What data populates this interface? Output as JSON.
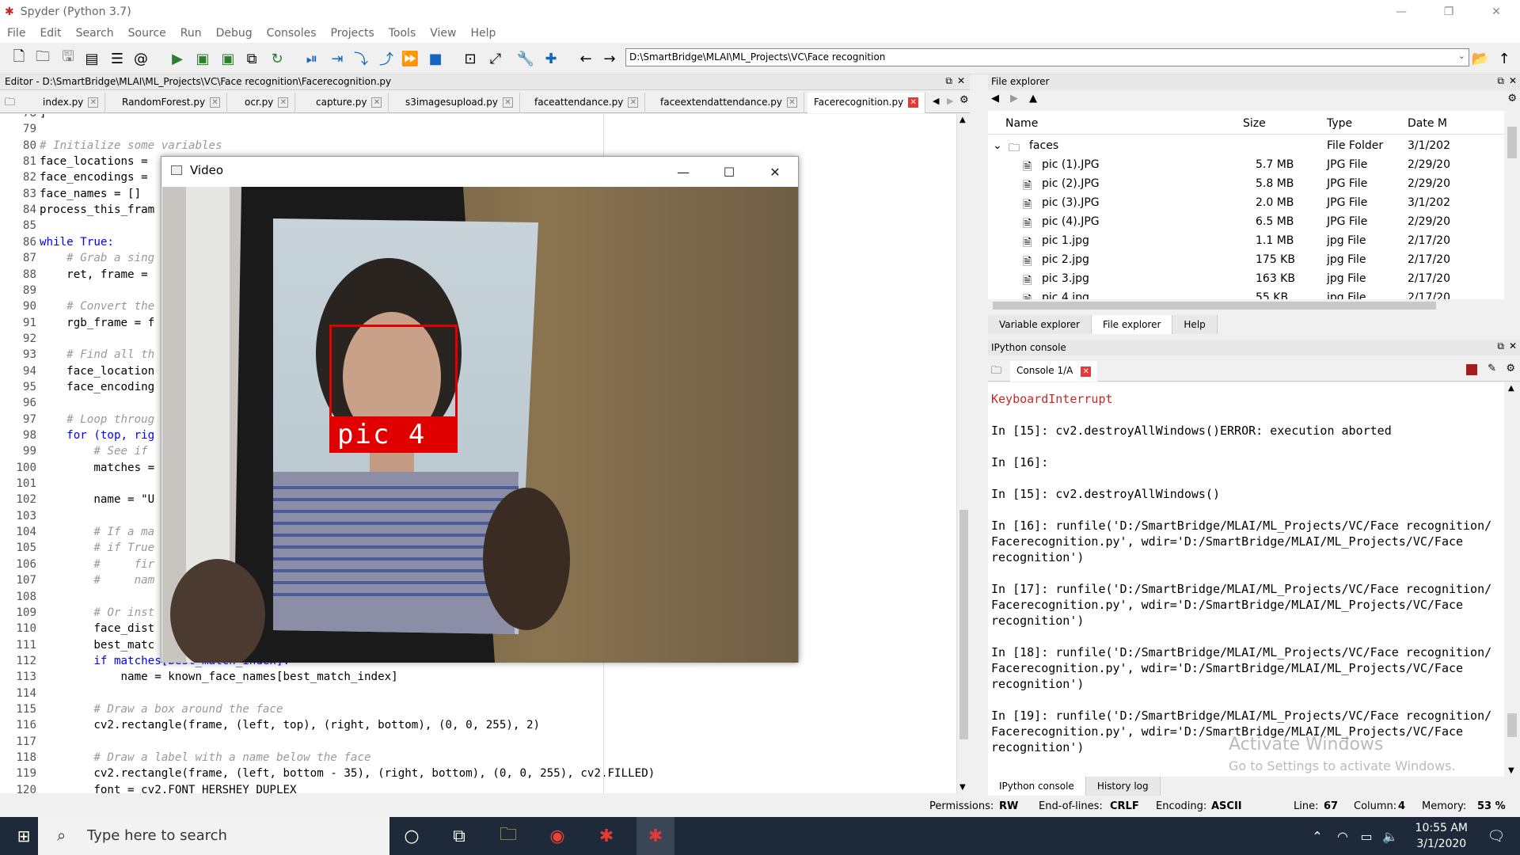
{
  "window": {
    "title": "Spyder (Python 3.7)",
    "minimize": "—",
    "restore": "❐",
    "close": "✕"
  },
  "menu": [
    "File",
    "Edit",
    "Search",
    "Source",
    "Run",
    "Debug",
    "Consoles",
    "Projects",
    "Tools",
    "View",
    "Help"
  ],
  "toolbar": {
    "path": "D:\\SmartBridge\\MLAI\\ML_Projects\\VC\\Face recognition"
  },
  "editor": {
    "header": "Editor - D:\\SmartBridge\\MLAI\\ML_Projects\\VC\\Face recognition\\Facerecognition.py",
    "tabs": [
      "index.py",
      "RandomForest.py",
      "ocr.py",
      "capture.py",
      "s3imagesupload.py",
      "faceattendance.py",
      "faceextendattendance.py",
      "Facerecognition.py"
    ],
    "active_tab": "Facerecognition.py",
    "lines": [
      {
        "n": "78",
        "t": "]",
        "c": ""
      },
      {
        "n": "79",
        "t": "",
        "c": ""
      },
      {
        "n": "80",
        "t": "# Initialize some variables",
        "c": "cm"
      },
      {
        "n": "81",
        "t": "face_locations = ",
        "c": ""
      },
      {
        "n": "82",
        "t": "face_encodings = ",
        "c": ""
      },
      {
        "n": "83",
        "t": "face_names = []",
        "c": ""
      },
      {
        "n": "84",
        "t": "process_this_fram",
        "c": ""
      },
      {
        "n": "85",
        "t": "",
        "c": ""
      },
      {
        "n": "86",
        "t": "while True:",
        "c": "kw"
      },
      {
        "n": "87",
        "t": "    # Grab a sing",
        "c": "cm"
      },
      {
        "n": "88",
        "t": "    ret, frame = ",
        "c": ""
      },
      {
        "n": "89",
        "t": "",
        "c": ""
      },
      {
        "n": "90",
        "t": "    # Convert the",
        "c": "cm"
      },
      {
        "n": "91",
        "t": "    rgb_frame = f",
        "c": ""
      },
      {
        "n": "92",
        "t": "",
        "c": ""
      },
      {
        "n": "93",
        "t": "    # Find all th",
        "c": "cm"
      },
      {
        "n": "94",
        "t": "    face_location",
        "c": ""
      },
      {
        "n": "95",
        "t": "    face_encoding",
        "c": ""
      },
      {
        "n": "96",
        "t": "",
        "c": ""
      },
      {
        "n": "97",
        "t": "    # Loop throug",
        "c": "cm"
      },
      {
        "n": "98",
        "t": "    for (top, rig",
        "c": "kw"
      },
      {
        "n": "99",
        "t": "        # See if",
        "c": "cm"
      },
      {
        "n": "100",
        "t": "        matches =",
        "c": ""
      },
      {
        "n": "101",
        "t": "",
        "c": ""
      },
      {
        "n": "102",
        "t": "        name = \"U",
        "c": ""
      },
      {
        "n": "103",
        "t": "",
        "c": ""
      },
      {
        "n": "104",
        "t": "        # If a ma",
        "c": "cm"
      },
      {
        "n": "105",
        "t": "        # if True",
        "c": "cm"
      },
      {
        "n": "106",
        "t": "        #     fir",
        "c": "cm"
      },
      {
        "n": "107",
        "t": "        #     nam",
        "c": "cm"
      },
      {
        "n": "108",
        "t": "",
        "c": ""
      },
      {
        "n": "109",
        "t": "        # Or inst",
        "c": "cm"
      },
      {
        "n": "110",
        "t": "        face_dist",
        "c": ""
      },
      {
        "n": "111",
        "t": "        best_matc",
        "c": ""
      },
      {
        "n": "112",
        "t": "        if matches[best_match_index]:",
        "c": "kw"
      },
      {
        "n": "113",
        "t": "            name = known_face_names[best_match_index]",
        "c": ""
      },
      {
        "n": "114",
        "t": "",
        "c": ""
      },
      {
        "n": "115",
        "t": "        # Draw a box around the face",
        "c": "cm"
      },
      {
        "n": "116",
        "t": "        cv2.rectangle(frame, (left, top), (right, bottom), (0, 0, 255), 2)",
        "c": ""
      },
      {
        "n": "117",
        "t": "",
        "c": ""
      },
      {
        "n": "118",
        "t": "        # Draw a label with a name below the face",
        "c": "cm"
      },
      {
        "n": "119",
        "t": "        cv2.rectangle(frame, (left, bottom - 35), (right, bottom), (0, 0, 255), cv2.FILLED)",
        "c": ""
      },
      {
        "n": "120",
        "t": "        font = cv2.FONT_HERSHEY_DUPLEX",
        "c": ""
      }
    ]
  },
  "video": {
    "title": "Video",
    "label": "pic 4"
  },
  "file_explorer": {
    "header": "File explorer",
    "columns": [
      "Name",
      "Size",
      "Type",
      "Date M"
    ],
    "folder": {
      "name": "faces",
      "type": "File Folder",
      "date": "3/1/202"
    },
    "files": [
      {
        "name": "pic (1).JPG",
        "size": "5.7 MB",
        "type": "JPG File",
        "date": "2/29/20"
      },
      {
        "name": "pic (2).JPG",
        "size": "5.8 MB",
        "type": "JPG File",
        "date": "2/29/20"
      },
      {
        "name": "pic (3).JPG",
        "size": "2.0 MB",
        "type": "JPG File",
        "date": "3/1/202"
      },
      {
        "name": "pic (4).JPG",
        "size": "6.5 MB",
        "type": "JPG File",
        "date": "2/29/20"
      },
      {
        "name": "pic 1.jpg",
        "size": "1.1 MB",
        "type": "jpg File",
        "date": "2/17/20"
      },
      {
        "name": "pic 2.jpg",
        "size": "175 KB",
        "type": "jpg File",
        "date": "2/17/20"
      },
      {
        "name": "pic 3.jpg",
        "size": "163 KB",
        "type": "jpg File",
        "date": "2/17/20"
      },
      {
        "name": "pic 4.jpg",
        "size": "55 KB",
        "type": "jpg File",
        "date": "2/17/20"
      }
    ],
    "tabs": [
      "Variable explorer",
      "File explorer",
      "Help"
    ]
  },
  "ipython": {
    "header": "IPython console",
    "console_tab": "Console 1/A",
    "lines": [
      {
        "t": "KeyboardInterrupt",
        "c": "err"
      },
      {
        "t": "",
        "c": ""
      },
      {
        "t": "In [15]: cv2.destroyAllWindows()ERROR: execution aborted",
        "c": ""
      },
      {
        "t": "",
        "c": ""
      },
      {
        "t": "In [16]:",
        "c": ""
      },
      {
        "t": "",
        "c": ""
      },
      {
        "t": "In [15]: cv2.destroyAllWindows()",
        "c": ""
      },
      {
        "t": "",
        "c": ""
      },
      {
        "t": "In [16]: runfile('D:/SmartBridge/MLAI/ML_Projects/VC/Face recognition/",
        "c": ""
      },
      {
        "t": "Facerecognition.py', wdir='D:/SmartBridge/MLAI/ML_Projects/VC/Face",
        "c": ""
      },
      {
        "t": "recognition')",
        "c": ""
      },
      {
        "t": "",
        "c": ""
      },
      {
        "t": "In [17]: runfile('D:/SmartBridge/MLAI/ML_Projects/VC/Face recognition/",
        "c": ""
      },
      {
        "t": "Facerecognition.py', wdir='D:/SmartBridge/MLAI/ML_Projects/VC/Face",
        "c": ""
      },
      {
        "t": "recognition')",
        "c": ""
      },
      {
        "t": "",
        "c": ""
      },
      {
        "t": "In [18]: runfile('D:/SmartBridge/MLAI/ML_Projects/VC/Face recognition/",
        "c": ""
      },
      {
        "t": "Facerecognition.py', wdir='D:/SmartBridge/MLAI/ML_Projects/VC/Face",
        "c": ""
      },
      {
        "t": "recognition')",
        "c": ""
      },
      {
        "t": "",
        "c": ""
      },
      {
        "t": "In [19]: runfile('D:/SmartBridge/MLAI/ML_Projects/VC/Face recognition/",
        "c": ""
      },
      {
        "t": "Facerecognition.py', wdir='D:/SmartBridge/MLAI/ML_Projects/VC/Face",
        "c": ""
      },
      {
        "t": "recognition')",
        "c": ""
      }
    ],
    "tabs": [
      "IPython console",
      "History log"
    ]
  },
  "watermark": {
    "line1": "Activate Windows",
    "line2": "Go to Settings to activate Windows."
  },
  "status": {
    "permissions_label": "Permissions:",
    "permissions": "RW",
    "eol_label": "End-of-lines:",
    "eol": "CRLF",
    "encoding_label": "Encoding:",
    "encoding": "ASCII",
    "line_label": "Line:",
    "line": "67",
    "column_label": "Column:",
    "column": "4",
    "memory_label": "Memory:",
    "memory": "53 %"
  },
  "taskbar": {
    "search_placeholder": "Type here to search",
    "time": "10:55 AM",
    "date": "3/1/2020"
  },
  "colors": {
    "accent_red": "#e00000",
    "taskbar": "#1e2a3a"
  }
}
